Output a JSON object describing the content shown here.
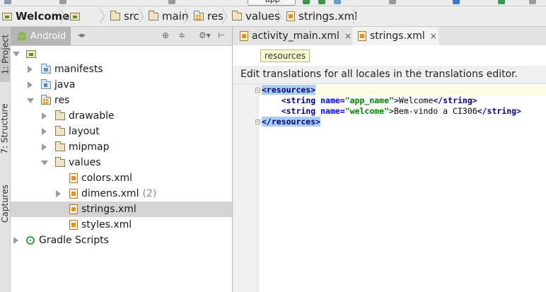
{
  "breadcrumb": {
    "project": "Welcome",
    "items": [
      "src",
      "main",
      "res",
      "values",
      "strings.xml"
    ]
  },
  "toolbar": {
    "run_config": "app"
  },
  "left_strip": {
    "tabs": [
      "1: Project",
      "7: Structure",
      "Captures"
    ]
  },
  "project_panel": {
    "view_mode": "Android",
    "tree": [
      {
        "label": "",
        "level": 0,
        "expanded": true,
        "icon": "module-icon"
      },
      {
        "label": "manifests",
        "level": 1,
        "expanded": false,
        "icon": "folder-icon"
      },
      {
        "label": "java",
        "level": 1,
        "expanded": false,
        "icon": "folder-icon"
      },
      {
        "label": "res",
        "level": 1,
        "expanded": true,
        "icon": "res-folder-icon"
      },
      {
        "label": "drawable",
        "level": 2,
        "expanded": false,
        "icon": "folder-icon"
      },
      {
        "label": "layout",
        "level": 2,
        "expanded": false,
        "icon": "folder-icon"
      },
      {
        "label": "mipmap",
        "level": 2,
        "expanded": false,
        "icon": "folder-icon"
      },
      {
        "label": "values",
        "level": 2,
        "expanded": true,
        "icon": "folder-icon"
      },
      {
        "label": "colors.xml",
        "level": 3,
        "expanded": null,
        "icon": "xml-file-icon"
      },
      {
        "label": "dimens.xml",
        "count": "(2)",
        "level": 3,
        "expanded": false,
        "icon": "xml-file-icon"
      },
      {
        "label": "strings.xml",
        "level": 3,
        "expanded": null,
        "icon": "xml-file-icon",
        "selected": true
      },
      {
        "label": "styles.xml",
        "level": 3,
        "expanded": null,
        "icon": "xml-file-icon"
      },
      {
        "label": "Gradle Scripts",
        "level": 0,
        "expanded": false,
        "icon": "gradle-icon"
      }
    ]
  },
  "editor": {
    "tabs": [
      {
        "label": "activity_main.xml",
        "close": "×",
        "active": false
      },
      {
        "label": "strings.xml",
        "close": "×",
        "active": true
      }
    ],
    "breadcrumb_popup": "resources",
    "notice": "Edit translations for all locales in the translations editor.",
    "code": {
      "resources_open": "<resources>",
      "resources_close": "</resources>",
      "lines": [
        {
          "indent": "    ",
          "open": "<string",
          "attr": " name=",
          "value": "\"app_name\"",
          "gt": ">",
          "text": "Welcome",
          "close": "</string",
          "end": ">"
        },
        {
          "indent": "    ",
          "open": "<string",
          "attr": " name=",
          "value": "\"welcome\"",
          "gt": ">",
          "text": "Bem-vindo a CI306",
          "close": "</string",
          "end": ">"
        }
      ]
    }
  }
}
